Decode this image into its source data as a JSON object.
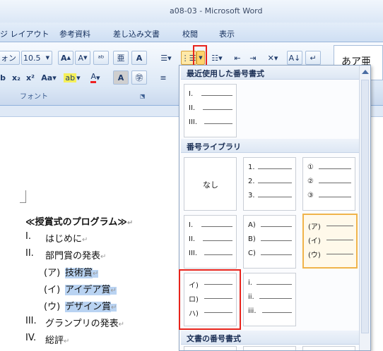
{
  "title": "a08-03 - Microsoft Word",
  "tabs": [
    "ジ レイアウト",
    "参考資料",
    "差し込み文書",
    "校閲",
    "表示"
  ],
  "font": {
    "name": "ォン",
    "size": "10.5"
  },
  "groups": {
    "font": "フォント"
  },
  "ribbon_right_preview": "あア亜",
  "document": {
    "heading": "≪授賞式のプログラム≫",
    "lines": [
      {
        "num": "I.",
        "text": "はじめに"
      },
      {
        "num": "II.",
        "text": "部門賞の発表"
      },
      {
        "num": "(ア)",
        "text": "技術賞"
      },
      {
        "num": "(イ)",
        "text": "アイデア賞"
      },
      {
        "num": "(ウ)",
        "text": "デザイン賞"
      },
      {
        "num": "III.",
        "text": "グランプリの発表"
      },
      {
        "num": "IV.",
        "text": "総評"
      }
    ]
  },
  "dropdown": {
    "recent_title": "最近使用した番号書式",
    "library_title": "番号ライブラリ",
    "document_title": "文書の番号書式",
    "none_label": "なし",
    "recent": [
      [
        "I.",
        "II.",
        "III."
      ]
    ],
    "library": [
      [
        "1.",
        "2.",
        "3."
      ],
      [
        "①",
        "②",
        "③"
      ],
      [
        "I.",
        "II.",
        "III."
      ],
      [
        "A)",
        "B)",
        "C)"
      ],
      [
        "(ア)",
        "(イ)",
        "(ウ)"
      ],
      [
        "イ)",
        "ロ)",
        "ハ)"
      ],
      [
        "i.",
        "ii.",
        "iii."
      ]
    ]
  }
}
